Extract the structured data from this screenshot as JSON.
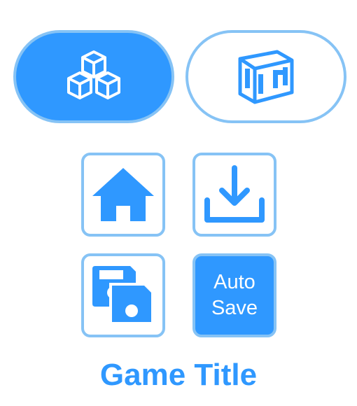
{
  "mode_toggle": {
    "items": [
      {
        "icon": "cubes-icon",
        "state": "selected"
      },
      {
        "icon": "cube-3d-icon",
        "state": "unselected"
      }
    ]
  },
  "actions": {
    "home_icon": "home-icon",
    "download_icon": "download-icon",
    "saves_icon": "save-files-icon",
    "autosave_line1": "Auto",
    "autosave_line2": "Save"
  },
  "game_title": "Game Title",
  "colors": {
    "accent": "#2f98ff",
    "border": "#86c3f5",
    "background": "#ffffff"
  }
}
